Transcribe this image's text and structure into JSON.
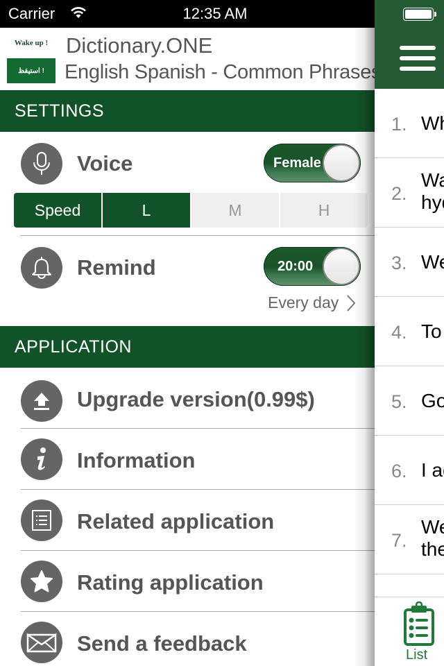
{
  "status_bar": {
    "carrier": "Carrier",
    "time": "12:35 AM"
  },
  "app": {
    "logo_top": "Wake up !",
    "logo_bottom": "استيقظ !",
    "title": "Dictionary.ONE",
    "subtitle": "English Spanish - Common Phrases"
  },
  "settings": {
    "header": "SETTINGS",
    "voice": {
      "label": "Voice",
      "toggle_value": "Female",
      "icon": "microphone-icon"
    },
    "speed": {
      "label": "Speed",
      "options": [
        "L",
        "M",
        "H"
      ],
      "selected": "L"
    },
    "remind": {
      "label": "Remind",
      "toggle_value": "20:00",
      "icon": "bell-icon",
      "repeat": "Every day"
    }
  },
  "application": {
    "header": "APPLICATION",
    "items": [
      {
        "label": "Upgrade version(0.99$)",
        "icon": "upload-icon"
      },
      {
        "label": "Information",
        "icon": "info-icon"
      },
      {
        "label": "Related application",
        "icon": "list-icon"
      },
      {
        "label": "Rating application",
        "icon": "star-icon"
      },
      {
        "label": "Send a feedback",
        "icon": "envelope-icon"
      }
    ]
  },
  "panel": {
    "menu_icon": "hamburger-icon",
    "phrases": [
      {
        "num": "1.",
        "text": "Wh"
      },
      {
        "num": "2.",
        "text": "Wa",
        "text2": "hyd"
      },
      {
        "num": "3.",
        "text": "We"
      },
      {
        "num": "4.",
        "text": "To"
      },
      {
        "num": "5.",
        "text": "Go"
      },
      {
        "num": "6.",
        "text": "I ag"
      },
      {
        "num": "7.",
        "text": "We",
        "text2": "the"
      }
    ],
    "tab": {
      "label": "List",
      "icon": "clipboard-list-icon"
    }
  },
  "colors": {
    "primary_green": "#115228",
    "header_green": "#245b35",
    "tab_green": "#1f7a3a",
    "icon_gray": "#666566"
  }
}
